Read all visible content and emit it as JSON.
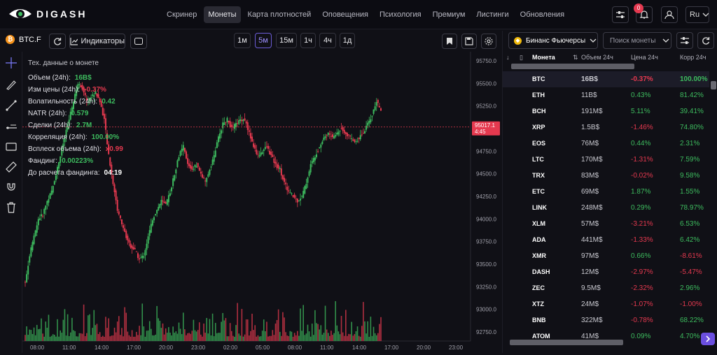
{
  "header": {
    "brand": "DIGASH",
    "nav": [
      "Скринер",
      "Монеты",
      "Карта плотностей",
      "Оповещения",
      "Психология",
      "Премиум",
      "Листинги",
      "Обновления"
    ],
    "active_nav": 1,
    "notification_count": "0",
    "language": "Ru"
  },
  "toolbar": {
    "symbol": "BTC.F",
    "indicators_label": "Индикаторы",
    "timeframes": [
      "1м",
      "5м",
      "15м",
      "1ч",
      "4ч",
      "1д"
    ],
    "active_timeframe": 1
  },
  "info": {
    "title": "Тех. данные о монете",
    "rows": [
      {
        "label": "Объем (24h):",
        "value": "16B$",
        "color": "green"
      },
      {
        "label": "Изм цены (24h):",
        "value": "-0.37%",
        "color": "red"
      },
      {
        "label": "Волатильность (24h):",
        "value": "0.42",
        "color": "green"
      },
      {
        "label": "NATR (24h):",
        "value": "0.579",
        "color": "green"
      },
      {
        "label": "Сделки (24h):",
        "value": "2.7M",
        "color": "green"
      },
      {
        "label": "Корреляция (24h):",
        "value": "100.00%",
        "color": "green"
      },
      {
        "label": "Всплеск объема (24h):",
        "value": "x0.99",
        "color": "red"
      },
      {
        "label": "Фандинг:",
        "value": "0.00223%",
        "color": "green"
      },
      {
        "label": "До расчета фандинга:",
        "value": "04:19",
        "color": "white"
      }
    ]
  },
  "chart_data": {
    "type": "candlestick",
    "y_ticks": [
      "95750.0",
      "95500.0",
      "95250.0",
      "95000.0",
      "94750.0",
      "94500.0",
      "94250.0",
      "94000.0",
      "93750.0",
      "93500.0",
      "93250.0",
      "93000.0",
      "92750.0"
    ],
    "x_ticks": [
      "08:00",
      "11:00",
      "14:00",
      "17:00",
      "20:00",
      "23:00",
      "02:00",
      "05:00",
      "08:00",
      "11:00",
      "14:00",
      "17:00",
      "20:00",
      "23:00"
    ],
    "ylim": [
      92650,
      95850
    ],
    "current_price": "95017.1",
    "countdown": "4:45",
    "close_series": [
      93300,
      93600,
      93800,
      94000,
      94050,
      94200,
      94300,
      94500,
      94700,
      94900,
      95100,
      95300,
      95500,
      95450,
      95300,
      95350,
      95400,
      95300,
      95100,
      94700,
      94400,
      94100,
      93950,
      93800,
      93700,
      93650,
      93550,
      93600,
      93800,
      94000,
      94100,
      94200,
      94150,
      94300,
      94500,
      94700,
      94800,
      94600,
      94550,
      94600,
      94500,
      94400,
      94550,
      94700,
      94900,
      95050,
      95100,
      95000,
      95050,
      95100,
      95100,
      94950,
      94800,
      94700,
      94750,
      94800,
      94700,
      94600,
      94550,
      94400,
      94300,
      94250,
      94200,
      94250,
      94400,
      94600,
      94700,
      94800,
      94900,
      94950,
      94900,
      94950,
      95000,
      94950,
      94900,
      94850,
      94900,
      94950,
      95050,
      95150,
      95300,
      95200
    ],
    "price_color_up": "#3dbb5e",
    "price_color_down": "#e5394f"
  },
  "markets": {
    "exchange": "Бинанс Фьючерсы",
    "search_placeholder": "Поиск монеты",
    "columns": [
      "Монета",
      "Объем 24ч",
      "Цена 24ч",
      "Корр 24ч"
    ],
    "rows": [
      [
        "BTC",
        "16B$",
        "-0.37%",
        "100.00%"
      ],
      [
        "ETH",
        "11B$",
        "0.43%",
        "81.42%"
      ],
      [
        "BCH",
        "191M$",
        "5.11%",
        "39.41%"
      ],
      [
        "XRP",
        "1.5B$",
        "-1.46%",
        "74.80%"
      ],
      [
        "EOS",
        "76M$",
        "0.44%",
        "2.31%"
      ],
      [
        "LTC",
        "170M$",
        "-1.31%",
        "7.59%"
      ],
      [
        "TRX",
        "83M$",
        "-0.02%",
        "9.58%"
      ],
      [
        "ETC",
        "69M$",
        "1.87%",
        "1.55%"
      ],
      [
        "LINK",
        "248M$",
        "0.29%",
        "78.97%"
      ],
      [
        "XLM",
        "57M$",
        "-3.21%",
        "6.53%"
      ],
      [
        "ADA",
        "441M$",
        "-1.33%",
        "6.42%"
      ],
      [
        "XMR",
        "97M$",
        "0.66%",
        "-8.61%"
      ],
      [
        "DASH",
        "12M$",
        "-2.97%",
        "-5.47%"
      ],
      [
        "ZEC",
        "9.5M$",
        "-2.32%",
        "2.96%"
      ],
      [
        "XTZ",
        "24M$",
        "-1.07%",
        "-1.00%"
      ],
      [
        "BNB",
        "322M$",
        "-0.78%",
        "68.22%"
      ],
      [
        "ATOM",
        "41M$",
        "0.09%",
        "4.70%"
      ]
    ]
  }
}
